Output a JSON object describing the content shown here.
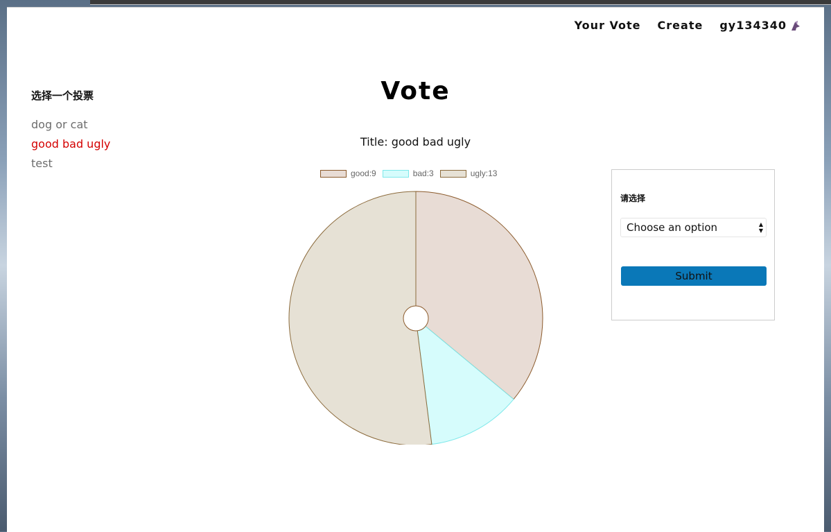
{
  "nav": {
    "your_vote": "Your Vote",
    "create": "Create",
    "username": "gy134340",
    "avatar_icon": "avatar-icon"
  },
  "sidebar": {
    "heading": "选择一个投票",
    "polls": [
      {
        "label": "dog or cat",
        "active": false
      },
      {
        "label": "good bad ugly",
        "active": true
      },
      {
        "label": "test",
        "active": false
      }
    ]
  },
  "page": {
    "title": "Vote",
    "poll_title": "Title: good bad ugly"
  },
  "vote_form": {
    "label": "请选择",
    "select_value": "Choose an option",
    "submit_label": "Submit"
  },
  "colors": {
    "accent_link": "#d40000",
    "button": "#0a78b8"
  },
  "chart_data": {
    "type": "pie",
    "doughnut": true,
    "legend_position": "top",
    "slices": [
      {
        "label": "good:9",
        "name": "good",
        "value": 9,
        "fill": "#e8dcd5",
        "stroke": "#8b5a2b"
      },
      {
        "label": "bad:3",
        "name": "bad",
        "value": 3,
        "fill": "#d6fcfc",
        "stroke": "#7ee8ea"
      },
      {
        "label": "ugly:13",
        "name": "ugly",
        "value": 13,
        "fill": "#e6e1d5",
        "stroke": "#8b6a3b"
      }
    ]
  }
}
